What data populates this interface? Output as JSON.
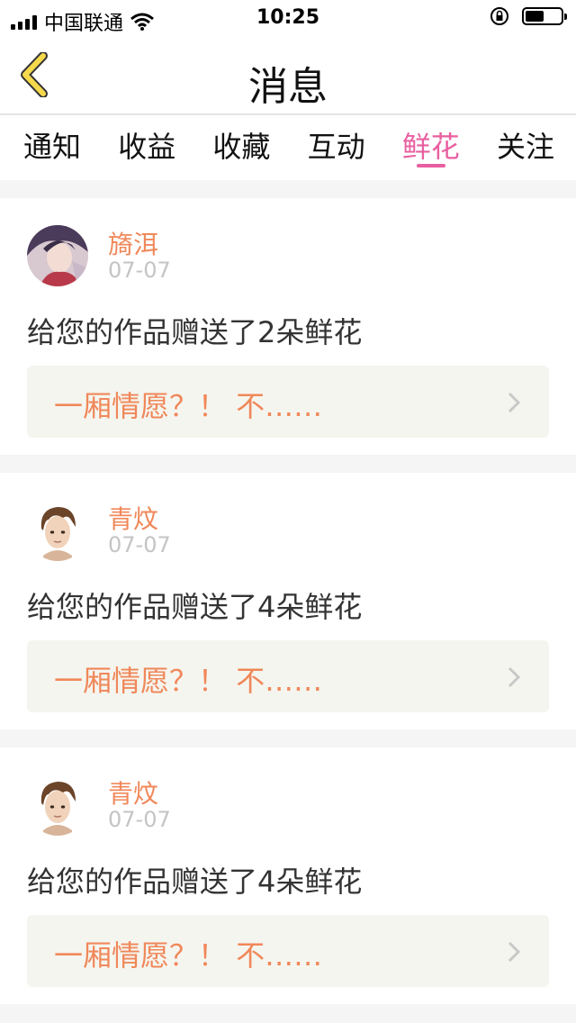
{
  "status_bar": {
    "carrier": "中国联通",
    "time": "10:25"
  },
  "nav": {
    "title": "消息"
  },
  "tabs": [
    {
      "label": "通知"
    },
    {
      "label": "收益"
    },
    {
      "label": "收藏"
    },
    {
      "label": "互动"
    },
    {
      "label": "鲜花",
      "active": true
    },
    {
      "label": "关注"
    }
  ],
  "messages": [
    {
      "user": "旖洱",
      "date": "07-07",
      "text": "给您的作品赠送了2朵鲜花",
      "work": "一厢情愿？！ 不……"
    },
    {
      "user": "青炆",
      "date": "07-07",
      "text": "给您的作品赠送了4朵鲜花",
      "work": "一厢情愿？！ 不……"
    },
    {
      "user": "青炆",
      "date": "07-07",
      "text": "给您的作品赠送了4朵鲜花",
      "work": "一厢情愿？！ 不……"
    }
  ],
  "colors": {
    "accent": "#e85fa0",
    "name": "#f0885a",
    "date": "#c4c4c4",
    "link_bg": "#f5f5ef",
    "back_icon": "#f5d94d"
  },
  "icons": {
    "back": "chevron-left-icon",
    "wifi": "wifi-icon",
    "lock": "orientation-lock-icon",
    "battery": "battery-icon",
    "link": "chevron-right-icon"
  }
}
